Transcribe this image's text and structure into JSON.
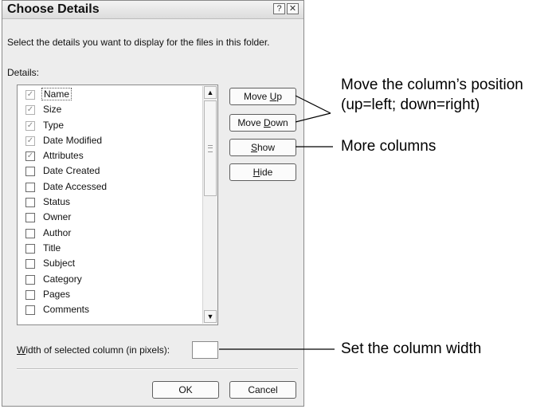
{
  "dialog": {
    "title": "Choose Details",
    "help_icon": "?",
    "close_icon": "✕",
    "instruction": "Select the details you want to display for the files in this folder.",
    "details_label": "Details:",
    "items": [
      {
        "label": "Name",
        "checked": true,
        "disabled": true,
        "selected": true
      },
      {
        "label": "Size",
        "checked": true,
        "disabled": true
      },
      {
        "label": "Type",
        "checked": true,
        "disabled": true
      },
      {
        "label": "Date Modified",
        "checked": true,
        "disabled": true
      },
      {
        "label": "Attributes",
        "checked": true
      },
      {
        "label": "Date Created",
        "checked": false
      },
      {
        "label": "Date Accessed",
        "checked": false
      },
      {
        "label": "Status",
        "checked": false
      },
      {
        "label": "Owner",
        "checked": false
      },
      {
        "label": "Author",
        "checked": false
      },
      {
        "label": "Title",
        "checked": false
      },
      {
        "label": "Subject",
        "checked": false
      },
      {
        "label": "Category",
        "checked": false
      },
      {
        "label": "Pages",
        "checked": false
      },
      {
        "label": "Comments",
        "checked": false
      }
    ],
    "buttons": {
      "move_up_prefix": "Move ",
      "move_up_key": "U",
      "move_up_suffix": "p",
      "move_down_prefix": "Move ",
      "move_down_key": "D",
      "move_down_suffix": "own",
      "show_key": "S",
      "show_suffix": "how",
      "hide_key": "H",
      "hide_suffix": "ide",
      "ok": "OK",
      "cancel": "Cancel"
    },
    "width_label_key": "W",
    "width_label_suffix": "idth of selected column (in pixels):",
    "width_value": ""
  },
  "callouts": {
    "move_line1": "Move the column’s position",
    "move_line2": "(up=left; down=right)",
    "more_columns": "More columns",
    "column_width": "Set the column width"
  }
}
